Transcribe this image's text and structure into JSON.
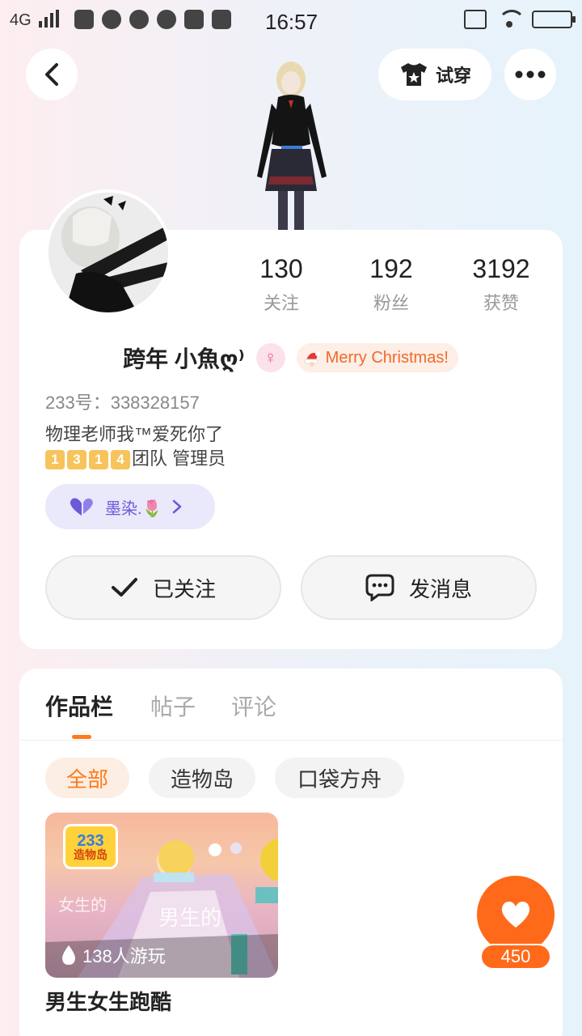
{
  "status_bar": {
    "network": "4G",
    "time": "16:57"
  },
  "header": {
    "try_on_label": "试穿"
  },
  "profile": {
    "stats": [
      {
        "value": "130",
        "label": "关注"
      },
      {
        "value": "192",
        "label": "粉丝"
      },
      {
        "value": "3192",
        "label": "获赞"
      }
    ],
    "name": "跨年  小魚ღ⁾",
    "gender_symbol": "♀",
    "badge_text": "Merry Christmas!",
    "uid": "233号：338328157",
    "bio_line1": "物理老师我™爱死你了",
    "bio_digits": [
      "1",
      "3",
      "1",
      "4"
    ],
    "bio_line2_suffix": "团队 管理员",
    "group_chip_label": "墨染.🌷",
    "follow_button": "已关注",
    "message_button": "发消息"
  },
  "works": {
    "tabs": [
      "作品栏",
      "帖子",
      "评论"
    ],
    "filters": [
      "全部",
      "造物岛",
      "口袋方舟"
    ],
    "game": {
      "logo_top": "233",
      "logo_bottom": "造物岛",
      "overlay_a": "女生的",
      "overlay_b": "男生的",
      "plays": "138人游玩",
      "title": "男生女生跑酷"
    },
    "like_count": "450"
  },
  "colors": {
    "accent": "#ff7a1a",
    "like_button": "#ff6a1a",
    "group_chip_text": "#6a5ad8",
    "gender_pink": "#e8608f"
  }
}
